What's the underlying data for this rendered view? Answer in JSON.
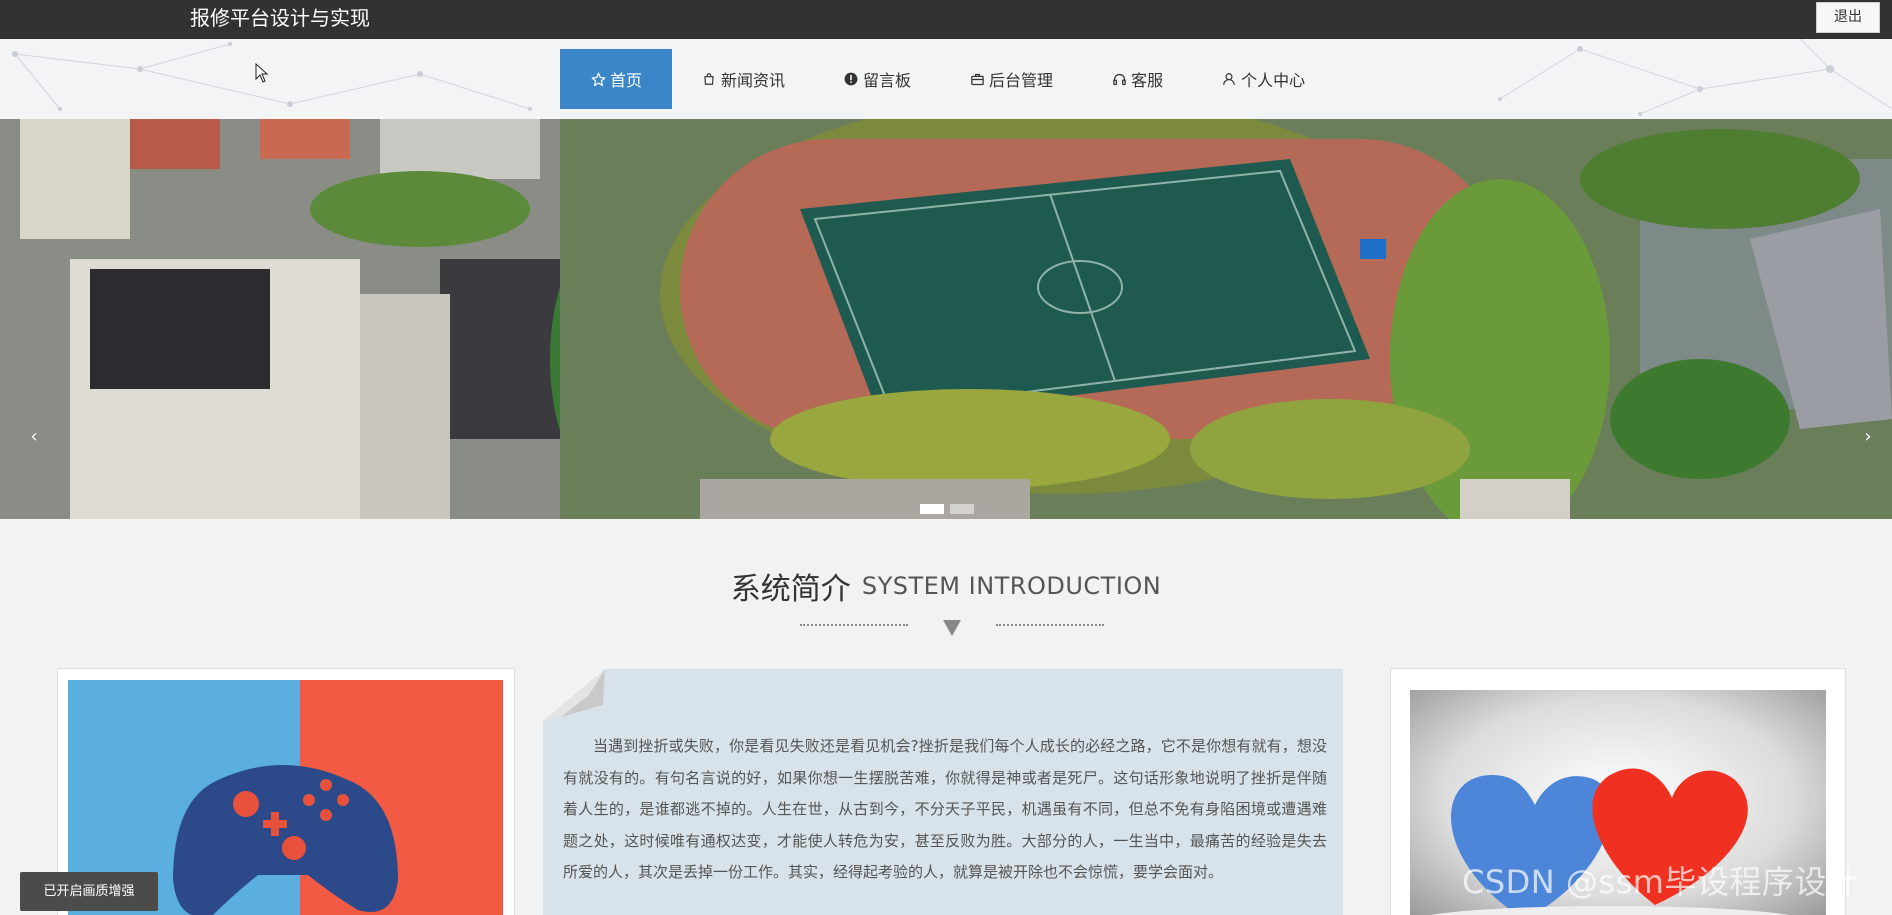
{
  "header": {
    "title": "报修平台设计与实现",
    "logout_label": "退出"
  },
  "nav": {
    "items": [
      {
        "label": "首页",
        "icon": "star-icon",
        "active": true
      },
      {
        "label": "新闻资讯",
        "icon": "bag-icon"
      },
      {
        "label": "留言板",
        "icon": "alert-circle-icon"
      },
      {
        "label": "后台管理",
        "icon": "briefcase-icon"
      },
      {
        "label": "客服",
        "icon": "headset-icon"
      },
      {
        "label": "个人中心",
        "icon": "user-icon"
      }
    ]
  },
  "banner": {
    "image": "aerial view of campus sports field with running track, trees and buildings",
    "prev_icon": "chevron-left-icon",
    "next_icon": "chevron-right-icon",
    "slide_count": 2,
    "active_slide": 1
  },
  "intro": {
    "title_cn": "系统简介",
    "title_en": "SYSTEM INTRODUCTION",
    "paragraph": "当遇到挫折或失败，你是看见失败还是看见机会?挫折是我们每个人成长的必经之路，它不是你想有就有，想没有就没有的。有句名言说的好，如果你想一生摆脱苦难，你就得是神或者是死尸。这句话形象地说明了挫折是伴随着人生的，是谁都逃不掉的。人生在世，从古到今，不分天子平民，机遇虽有不同，但总不免有身陷困境或遭遇难题之处，这时候唯有通权达变，才能使人转危为安，甚至反败为胜。大部分的人，一生当中，最痛苦的经验是失去所爱的人，其次是丢掉一份工作。其实，经得起考验的人，就算是被开除也不会惊慌，要学会面对。",
    "left_image": "game controller illustration on blue and red background",
    "right_image": "blue and red heart-shaped ice sculptures on snow"
  },
  "overlay": {
    "enhance_label": "已开启画质增强",
    "watermark": "CSDN @ssm毕设程序设计"
  },
  "colors": {
    "topbar": "#323232",
    "nav_active": "#3a86c8",
    "intro_box": "#d7e2ea"
  }
}
